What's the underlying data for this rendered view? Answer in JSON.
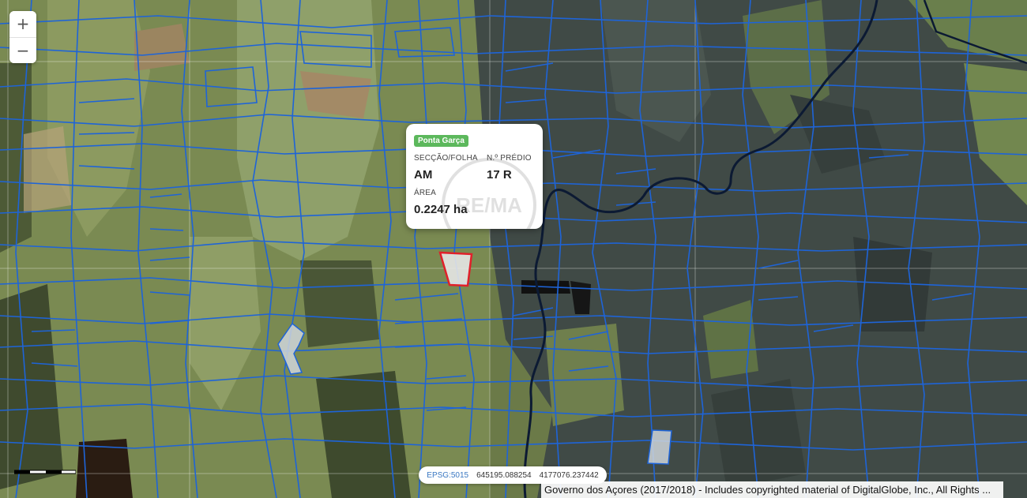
{
  "map": {
    "zoom_in_label": "+",
    "zoom_out_label": "−",
    "parcel_line_color": "#1e64d8",
    "highlight_color": "#e0202a",
    "stream_color": "#0c1a33"
  },
  "popup": {
    "badge": "Ponta Garça",
    "badge_color": "#5cb85c",
    "section_label": "SECÇÃO/FOLHA",
    "section_value": "AM",
    "predio_label": "N.º PRÉDIO",
    "predio_value": "17 R",
    "area_label": "ÁREA",
    "area_value": "0.2247 ha",
    "watermark_text": "RE/MA"
  },
  "coords": {
    "epsg": "EPSG:5015",
    "x": "645195.088254",
    "y": "4177076.237442"
  },
  "attribution": "Governo dos Açores (2017/2018) - Includes copyrighted material of DigitalGlobe, Inc., All Rights ..."
}
